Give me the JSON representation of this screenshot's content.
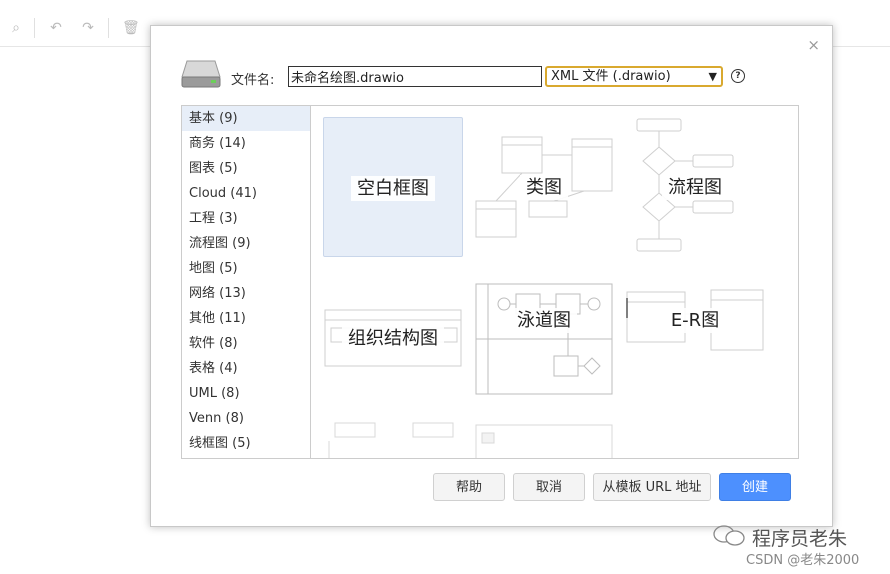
{
  "dialog": {
    "filename_label": "文件名:",
    "filename_value": "未命名绘图.drawio",
    "filetype_value": "XML 文件 (.drawio)",
    "help_glyph": "?",
    "close_glyph": "×"
  },
  "categories": [
    "基本 (9)",
    "商务 (14)",
    "图表 (5)",
    "Cloud (41)",
    "工程 (3)",
    "流程图 (9)",
    "地图 (5)",
    "网络 (13)",
    "其他 (11)",
    "软件 (8)",
    "表格 (4)",
    "UML (8)",
    "Venn (8)",
    "线框图 (5)"
  ],
  "templates": {
    "blank": "空白框图",
    "class": "类图",
    "flowchart": "流程图",
    "orgchart": "组织结构图",
    "swimlane": "泳道图",
    "er": "E-R图"
  },
  "buttons": {
    "help": "帮助",
    "cancel": "取消",
    "from_url": "从模板 URL 地址",
    "create": "创建"
  },
  "watermark": {
    "brand": "程序员老朱",
    "credit": "CSDN @老朱2000"
  },
  "colors": {
    "accent": "#4d90fe",
    "select_border": "#d9a92f",
    "selection_bg": "#e7eef8"
  }
}
